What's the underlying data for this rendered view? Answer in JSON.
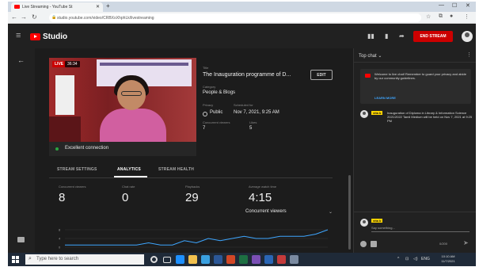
{
  "browser": {
    "tab_title": "Live Streaming - YouTube St",
    "url": "studio.youtube.com/video/CRBXoXhphLk/livestreaming"
  },
  "studio": {
    "brand": "Studio",
    "end_stream_label": "END STREAM"
  },
  "stream": {
    "live_badge": "LIVE",
    "duration": "36:34",
    "title_label": "Title",
    "title_value": "The Inauguration programme of D...",
    "edit_label": "EDIT",
    "category_label": "Category",
    "category_value": "People & Blogs",
    "privacy_label": "Privacy",
    "privacy_value": "Public",
    "scheduled_label": "Scheduled for",
    "scheduled_value": "Nov 7, 2021, 9:25 AM",
    "concurrent_label": "Concurrent viewers",
    "concurrent_value": "7",
    "likes_label": "Likes",
    "likes_value": "5",
    "connection": "Excellent connection"
  },
  "tabs": [
    "STREAM SETTINGS",
    "ANALYTICS",
    "STREAM HEALTH"
  ],
  "analytics": {
    "concurrent_label": "Concurrent viewers",
    "concurrent_value": "8",
    "chat_label": "Chat rate",
    "chat_value": "0",
    "playbacks_label": "Playbacks",
    "playbacks_value": "29",
    "watch_label": "Average watch time",
    "watch_value": "4:15",
    "dropdown_value": "Concurrent viewers",
    "graph_values": [
      1,
      1,
      1,
      1,
      1,
      1,
      1,
      2,
      1,
      1,
      3,
      2,
      4,
      3,
      4,
      5,
      4,
      4,
      5,
      5,
      5,
      6,
      8
    ],
    "graph_ticks": [
      "8",
      "4",
      "0"
    ]
  },
  "chat": {
    "header": "Top chat",
    "welcome": "Welcome to live chat! Remember to guard your privacy and abide by our community guidelines.",
    "learn_more": "LEARN MORE",
    "message_user": "vita b",
    "message_text": "Inauguration of Diploma in Library & Information Science 2021/2022 Tamil Medium will be held on Nov 7, 2021 at 9:25 PM",
    "input_user": "vita b",
    "input_placeholder": "Say something...",
    "char_counter": "0/200"
  },
  "taskbar": {
    "search_placeholder": "Type here to search",
    "lang": "ENG",
    "time": "10:10 AM",
    "date": "11/7/2021"
  }
}
